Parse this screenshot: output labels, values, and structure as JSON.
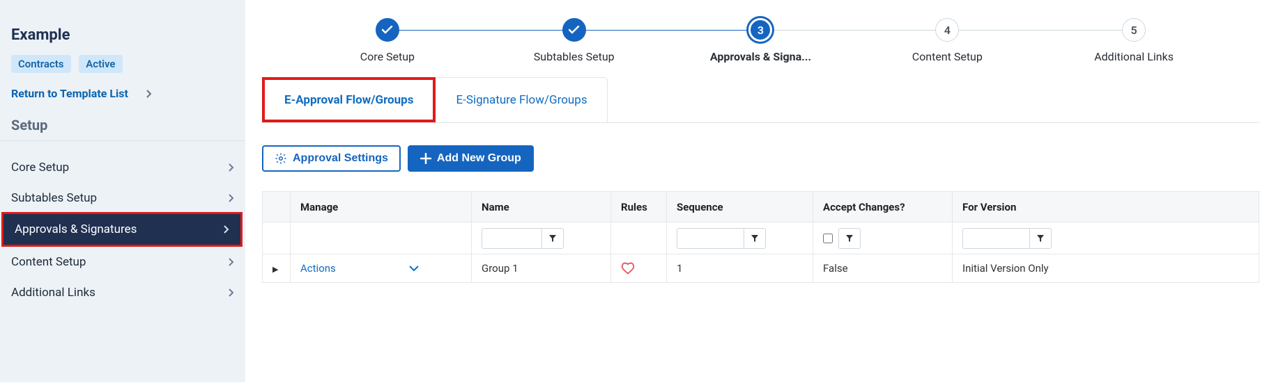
{
  "sidebar": {
    "title": "Example",
    "tags": [
      "Contracts",
      "Active"
    ],
    "return_label": "Return to Template List",
    "setup_label": "Setup",
    "items": [
      {
        "label": "Core Setup"
      },
      {
        "label": "Subtables Setup"
      },
      {
        "label": "Approvals & Signatures"
      },
      {
        "label": "Content Setup"
      },
      {
        "label": "Additional Links"
      }
    ]
  },
  "stepper": {
    "steps": [
      {
        "label": "Core Setup",
        "state": "done"
      },
      {
        "label": "Subtables Setup",
        "state": "done"
      },
      {
        "label": "Approvals & Signa...",
        "state": "current",
        "num": "3"
      },
      {
        "label": "Content Setup",
        "state": "todo",
        "num": "4"
      },
      {
        "label": "Additional Links",
        "state": "todo",
        "num": "5"
      }
    ]
  },
  "tabs": {
    "eapproval": "E-Approval Flow/Groups",
    "esignature": "E-Signature Flow/Groups"
  },
  "buttons": {
    "approval_settings": "Approval Settings",
    "add_group": "Add New Group"
  },
  "grid": {
    "headers": {
      "manage": "Manage",
      "name": "Name",
      "rules": "Rules",
      "sequence": "Sequence",
      "accept": "Accept Changes?",
      "version": "For Version"
    },
    "row": {
      "actions": "Actions",
      "name": "Group 1",
      "sequence": "1",
      "accept": "False",
      "version": "Initial Version Only"
    }
  }
}
